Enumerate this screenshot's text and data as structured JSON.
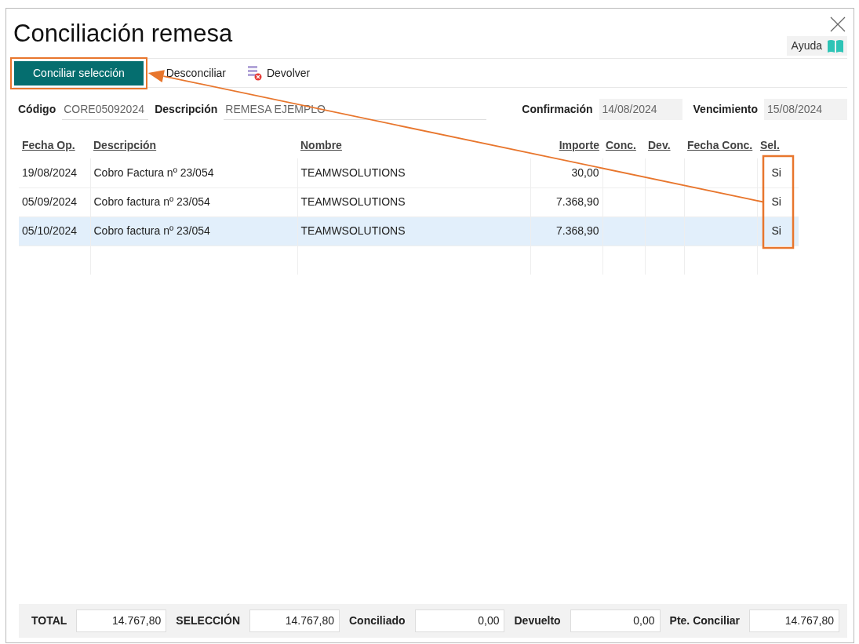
{
  "window": {
    "title": "Conciliación remesa",
    "help_label": "Ayuda"
  },
  "toolbar": [
    {
      "label": "Conciliar selección",
      "kind": "primary"
    },
    {
      "label": "Desconciliar",
      "kind": "plain"
    },
    {
      "label": "Devolver",
      "kind": "icon"
    }
  ],
  "header_fields": [
    {
      "label": "Código",
      "value": "CORE05092024",
      "kind": "underline"
    },
    {
      "label": "Descripción",
      "value": "REMESA EJEMPLO",
      "kind": "underline"
    },
    {
      "label": "Confirmación",
      "value": "14/08/2024",
      "kind": "filled"
    },
    {
      "label": "Vencimiento",
      "value": "15/08/2024",
      "kind": "filled"
    }
  ],
  "table": {
    "columns": [
      "Fecha Op.",
      "Descripción",
      "Nombre",
      "Importe",
      "Conc.",
      "Dev.",
      "Fecha Conc.",
      "Sel."
    ],
    "rows": [
      {
        "cells": [
          "19/08/2024",
          "Cobro Factura nº 23/054",
          "TEAMWSOLUTIONS",
          "30,00",
          "",
          "",
          "",
          "Si"
        ],
        "selected": false
      },
      {
        "cells": [
          "05/09/2024",
          "Cobro factura nº 23/054",
          "TEAMWSOLUTIONS",
          "7.368,90",
          "",
          "",
          "",
          "Si"
        ],
        "selected": false
      },
      {
        "cells": [
          "05/10/2024",
          "Cobro factura nº 23/054",
          "TEAMWSOLUTIONS",
          "7.368,90",
          "",
          "",
          "",
          "Si"
        ],
        "selected": true
      }
    ]
  },
  "totals": [
    {
      "label": "TOTAL",
      "value": "14.767,80"
    },
    {
      "label": "SELECCIÓN",
      "value": "14.767,80"
    },
    {
      "label": "Conciliado",
      "value": "0,00"
    },
    {
      "label": "Devuelto",
      "value": "0,00"
    },
    {
      "label": "Pte. Conciliar",
      "value": "14.767,80"
    }
  ]
}
